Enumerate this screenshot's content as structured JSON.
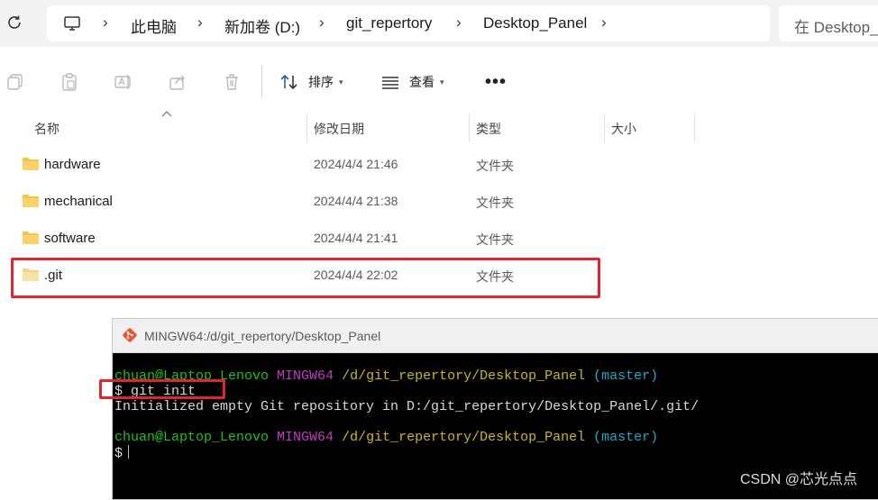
{
  "address_bar": {
    "breadcrumbs": [
      "此电脑",
      "新加卷 (D:)",
      "git_repertory",
      "Desktop_Panel"
    ],
    "separator": "›",
    "search_placeholder": "在 Desktop_Panel 中搜索"
  },
  "toolbar": {
    "icons": [
      "copy-icon",
      "paste-icon",
      "rename-icon",
      "share-icon",
      "delete-icon"
    ],
    "sort_label": "排序",
    "view_label": "查看",
    "more_label": "•••"
  },
  "columns": {
    "name": "名称",
    "modified": "修改日期",
    "type": "类型",
    "size": "大小"
  },
  "files": [
    {
      "name": "hardware",
      "modified": "2024/4/4 21:46",
      "type": "文件夹",
      "hidden": false
    },
    {
      "name": "mechanical",
      "modified": "2024/4/4 21:38",
      "type": "文件夹",
      "hidden": false
    },
    {
      "name": "software",
      "modified": "2024/4/4 21:41",
      "type": "文件夹",
      "hidden": false
    },
    {
      "name": ".git",
      "modified": "2024/4/4 22:02",
      "type": "文件夹",
      "hidden": true
    }
  ],
  "terminal": {
    "title": "MINGW64:/d/git_repertory/Desktop_Panel",
    "prompt_user": "chuan@Laptop_Lenovo",
    "prompt_env": "MINGW64",
    "prompt_path": "/d/git_repertory/Desktop_Panel",
    "prompt_branch": "(master)",
    "command": "$ git init",
    "output": "Initialized empty Git repository in D:/git_repertory/Desktop_Panel/.git/",
    "final_prompt": "$"
  },
  "watermark": "CSDN @芯光点点",
  "colors": {
    "highlight": "#e0262b",
    "folder": "#f5c24a",
    "hidden_folder": "#f9e2a6",
    "term_green": "#1ec21e",
    "term_magenta": "#c23cc2",
    "term_yellow": "#c9b621",
    "term_cyan": "#22a7c4"
  }
}
